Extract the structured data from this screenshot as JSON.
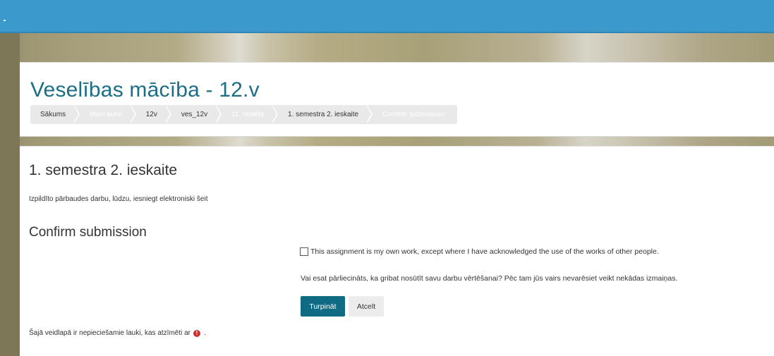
{
  "course": {
    "title": "Veselības mācība - 12.v"
  },
  "breadcrumb": [
    {
      "label": "Sākums"
    },
    {
      "label": "Mani kursi"
    },
    {
      "label": "12v"
    },
    {
      "label": "ves_12v"
    },
    {
      "label": "11. nedēļa"
    },
    {
      "label": "1. semestra 2. ieskaite"
    },
    {
      "label": "Confirm submission"
    }
  ],
  "assignment": {
    "title": "1. semestra 2. ieskaite",
    "intro": "Izpildīto pārbaudes darbu, lūdzu, iesniegt elektroniski šeit"
  },
  "confirm": {
    "heading": "Confirm submission",
    "statement_label": "This assignment is my own work, except where I have acknowledged the use of the works of other people.",
    "statement_checked": false,
    "question": "Vai esat pārliecināts, ka gribat nosūtīt savu darbu vērtēšanai? Pēc tam jūs vairs nevarēsiet veikt nekādas izmaiņas.",
    "continue_label": "Turpināt",
    "cancel_label": "Atcelt"
  },
  "form": {
    "required_note": "Šajā veidlapā ir nepieciešamie lauki, kas atzīmēti ar",
    "required_note_end": ".",
    "required_icon": "exclamation-circle-icon"
  },
  "colors": {
    "topbar": "#3b99cc",
    "title": "#1b6e85",
    "primary_button": "#0f6b83",
    "required_icon": "#c9302c"
  }
}
